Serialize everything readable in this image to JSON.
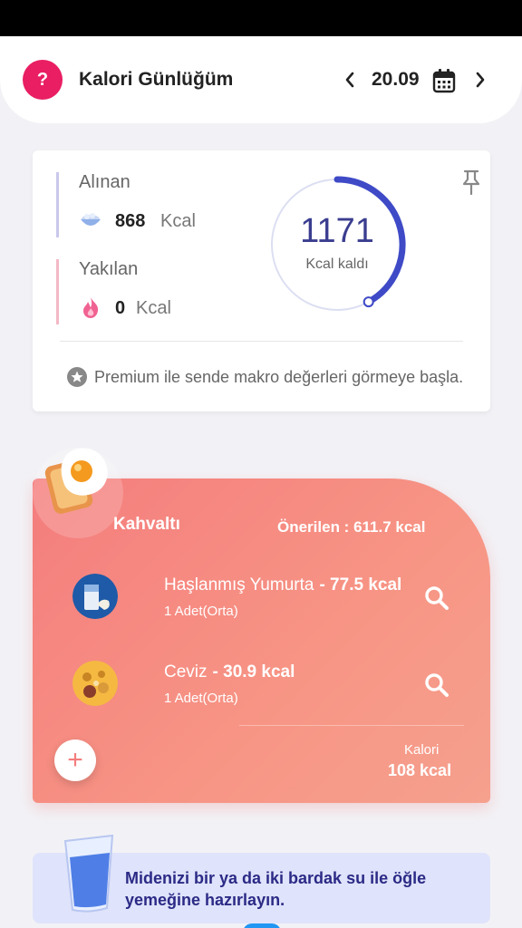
{
  "header": {
    "help_symbol": "?",
    "title": "Kalori Günlüğüm",
    "date": "20.09"
  },
  "summary": {
    "taken_label": "Alınan",
    "taken_value": "868",
    "taken_unit": "Kcal",
    "burned_label": "Yakılan",
    "burned_value": "0",
    "burned_unit": "Kcal",
    "remaining_value": "1171",
    "remaining_label": "Kcal kaldı",
    "ring_progress": 0.42,
    "premium_text": "Premium ile sende makro değerleri görmeye başla."
  },
  "meal": {
    "title": "Kahvaltı",
    "suggested": "Önerilen : 611.7 kcal",
    "items": [
      {
        "name": "Haşlanmış Yumurta",
        "kcal": "- 77.5  kcal",
        "portion": "1 Adet(Orta)"
      },
      {
        "name": "Ceviz",
        "kcal": "- 30.9  kcal",
        "portion": "1 Adet(Orta)"
      }
    ],
    "add_symbol": "+",
    "total_label": "Kalori",
    "total_value": "108 kcal"
  },
  "water_tip": "Midenizi bir ya da iki bardak su ile öğle yemeğine hazırlayın.",
  "colors": {
    "accent_pink": "#e91e63",
    "ring_blue": "#3f4ac7",
    "meal_coral": "#f47d7d",
    "tip_bg": "#dfe3fb",
    "tip_text": "#2b2a86"
  },
  "icons": [
    "help-icon",
    "chevron-left-icon",
    "chevron-right-icon",
    "calendar-icon",
    "bowl-icon",
    "flame-icon",
    "pin-icon",
    "star-icon",
    "egg-toast-icon",
    "milk-icon",
    "walnut-icon",
    "search-icon",
    "plus-icon",
    "water-glass-icon"
  ]
}
